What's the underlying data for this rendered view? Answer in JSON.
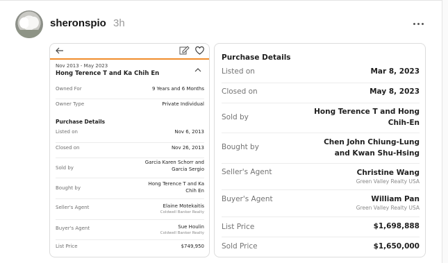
{
  "post": {
    "username": "sheronspio",
    "time": "3h"
  },
  "colors": {
    "accent": "#f08c2a"
  },
  "icons": [
    "more-icon",
    "back-arrow-icon",
    "edit-icon",
    "heart-icon",
    "chevron-up-icon"
  ],
  "left_card": {
    "date_range": "Nov 2013 - May 2023",
    "owner": "Hong Terence T and Ka Chih En",
    "owned_for_label": "Owned For",
    "owned_for_value": "9 Years and 6 Months",
    "owner_type_label": "Owner Type",
    "owner_type_value": "Private Individual",
    "section_title": "Purchase Details",
    "listed_on_label": "Listed on",
    "listed_on_value": "Nov 6, 2013",
    "closed_on_label": "Closed on",
    "closed_on_value": "Nov 26, 2013",
    "sold_by_label": "Sold by",
    "sold_by_value_1": "Garcia Karen Schorr and",
    "sold_by_value_2": "Garcia Sergio",
    "bought_by_label": "Bought by",
    "bought_by_value_1": "Hong Terence T and Ka",
    "bought_by_value_2": "Chih En",
    "sellers_agent_label": "Seller's Agent",
    "sellers_agent_value": "Elaine Motekaitis",
    "sellers_agent_brokerage": "Coldwell Banker Realty",
    "buyers_agent_label": "Buyer's Agent",
    "buyers_agent_value": "Sue Houlin",
    "buyers_agent_brokerage": "Coldwell Banker Realty",
    "list_price_label": "List Price",
    "list_price_value": "$749,950"
  },
  "right_card": {
    "title": "Purchase Details",
    "listed_on_label": "Listed on",
    "listed_on_value": "Mar 8, 2023",
    "closed_on_label": "Closed on",
    "closed_on_value": "May 8, 2023",
    "sold_by_label": "Sold by",
    "sold_by_value_1": "Hong Terence T and Hong",
    "sold_by_value_2": "Chih-En",
    "bought_by_label": "Bought by",
    "bought_by_value_1": "Chen John Chiung-Lung",
    "bought_by_value_2": "and Kwan Shu-Hsing",
    "sellers_agent_label": "Seller's Agent",
    "sellers_agent_value": "Christine Wang",
    "sellers_agent_brokerage": "Green Valley Realty USA",
    "buyers_agent_label": "Buyer's Agent",
    "buyers_agent_value": "William Pan",
    "buyers_agent_brokerage": "Green Valley Realty USA",
    "list_price_label": "List Price",
    "list_price_value": "$1,698,888",
    "sold_price_label": "Sold Price",
    "sold_price_value": "$1,650,000"
  }
}
